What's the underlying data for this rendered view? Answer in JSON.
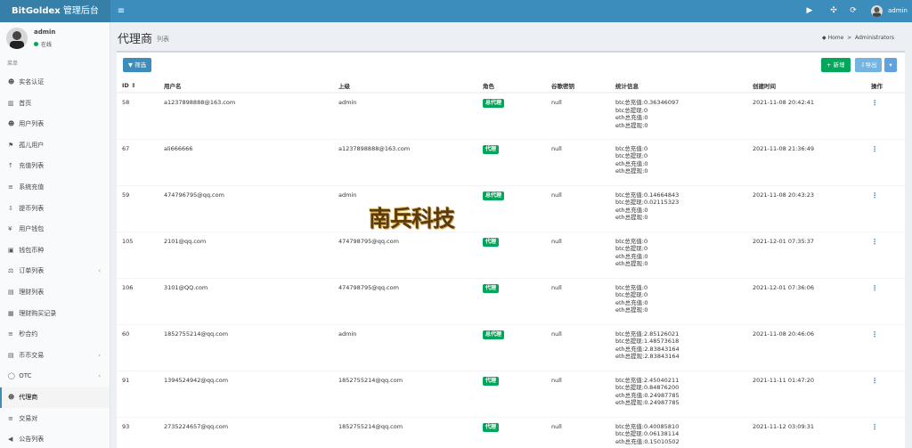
{
  "header": {
    "brand_bold": "BitGoldex",
    "brand_light": " 管理后台",
    "username": "admin"
  },
  "sidebar": {
    "user_name": "admin",
    "status": "在线",
    "menu_header": "菜单",
    "items": [
      {
        "label": "实名认证",
        "icon": "id-card-icon",
        "glyph": "☻"
      },
      {
        "label": "首页",
        "icon": "bar-chart-icon",
        "glyph": "▥"
      },
      {
        "label": "用户列表",
        "icon": "user-icon",
        "glyph": "☻"
      },
      {
        "label": "孤儿用户",
        "icon": "user-icon",
        "glyph": "⚑"
      },
      {
        "label": "充值列表",
        "icon": "up-arrow-icon",
        "glyph": "↑"
      },
      {
        "label": "系统充值",
        "icon": "list-icon",
        "glyph": "≡"
      },
      {
        "label": "提币列表",
        "icon": "download-icon",
        "glyph": "⇩"
      },
      {
        "label": "用户钱包",
        "icon": "yen-icon",
        "glyph": "¥"
      },
      {
        "label": "钱包币种",
        "icon": "wallet-icon",
        "glyph": "▣"
      },
      {
        "label": "订单列表",
        "icon": "balance-icon",
        "glyph": "⚖"
      },
      {
        "label": "理财列表",
        "icon": "file-icon",
        "glyph": "▤"
      },
      {
        "label": "理财购买记录",
        "icon": "grid-icon",
        "glyph": "▦"
      },
      {
        "label": "秒合约",
        "icon": "list-icon",
        "glyph": "≡"
      },
      {
        "label": "币币交易",
        "icon": "file-icon",
        "glyph": "▤"
      },
      {
        "label": "OTC",
        "icon": "circle-icon",
        "glyph": "◯"
      },
      {
        "label": "代理商",
        "icon": "users-icon",
        "glyph": "☻"
      },
      {
        "label": "交易对",
        "icon": "list-icon",
        "glyph": "≡"
      },
      {
        "label": "公告列表",
        "icon": "megaphone-icon",
        "glyph": "◀"
      }
    ]
  },
  "page": {
    "title": "代理商",
    "subtitle": "列表",
    "crumb_home": "Home",
    "crumb_current": "Administrators"
  },
  "toolbar": {
    "filter_label": "筛选",
    "new_label": "新增",
    "export_label": "导出"
  },
  "table": {
    "columns": [
      "ID ⇕",
      "用户名",
      "上级",
      "角色",
      "谷歌密钥",
      "统计信息",
      "创建时间",
      "操作"
    ],
    "rows": [
      {
        "id": "58",
        "username": "a1237898888@163.com",
        "parent": "admin",
        "role": "总代理",
        "google": "null",
        "stats": [
          "btc总充值:0.36346097",
          "btc总提现:0",
          "eth总充值:0",
          "eth总提现:0"
        ],
        "created": "2021-11-08 20:42:41"
      },
      {
        "id": "67",
        "username": "ali666666",
        "parent": "a1237898888@163.com",
        "role": "代理",
        "google": "null",
        "stats": [
          "btc总充值:0",
          "btc总提现:0",
          "eth总充值:0",
          "eth总提现:0"
        ],
        "created": "2021-11-08 21:36:49"
      },
      {
        "id": "59",
        "username": "474796795@qq.com",
        "parent": "admin",
        "role": "总代理",
        "google": "null",
        "stats": [
          "btc总充值:0.14664843",
          "btc总提现:0.02115323",
          "eth总充值:0",
          "eth总提现:0"
        ],
        "created": "2021-11-08 20:43:23"
      },
      {
        "id": "105",
        "username": "2101@qq.com",
        "parent": "474798795@qq.com",
        "role": "代理",
        "google": "null",
        "stats": [
          "btc总充值:0",
          "btc总提现:0",
          "eth总充值:0",
          "eth总提现:0"
        ],
        "created": "2021-12-01 07:35:37"
      },
      {
        "id": "106",
        "username": "3101@QQ.com",
        "parent": "474798795@qq.com",
        "role": "代理",
        "google": "null",
        "stats": [
          "btc总充值:0",
          "btc总提现:0",
          "eth总充值:0",
          "eth总提现:0"
        ],
        "created": "2021-12-01 07:36:06"
      },
      {
        "id": "60",
        "username": "1852755214@qq.com",
        "parent": "admin",
        "role": "总代理",
        "google": "null",
        "stats": [
          "btc总充值:2.85126021",
          "btc总提现:1.48573618",
          "eth总充值:2.83843164",
          "eth总提现:2.83843164"
        ],
        "created": "2021-11-08 20:46:06"
      },
      {
        "id": "91",
        "username": "1394524942@qq.com",
        "parent": "1852755214@qq.com",
        "role": "代理",
        "google": "null",
        "stats": [
          "btc总充值:2.45040211",
          "btc总提现:0.84876200",
          "eth总充值:0.24987785",
          "eth总提现:0.24987785"
        ],
        "created": "2021-11-11 01:47:20"
      },
      {
        "id": "93",
        "username": "2735224657@qq.com",
        "parent": "1852755214@qq.com",
        "role": "代理",
        "google": "null",
        "stats": [
          "btc总充值:0.40085810",
          "btc总提现:0.06138114",
          "eth总充值:0.15010502",
          ""
        ],
        "created": "2021-11-12 03:09:31"
      }
    ]
  },
  "watermark": "南兵科技"
}
